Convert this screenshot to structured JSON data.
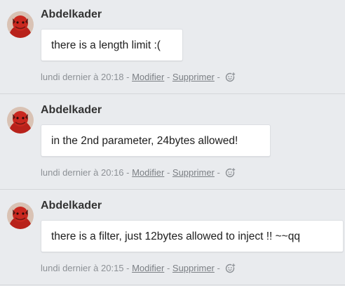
{
  "colors": {
    "background": "#e9ebee",
    "bubble": "#ffffff",
    "meta_text": "#8d9196",
    "author_text": "#333333"
  },
  "messages": [
    {
      "author": "Abdelkader",
      "text": "there is a length limit :(",
      "timestamp": "lundi dernier à 20:18",
      "edit_label": "Modifier",
      "delete_label": "Supprimer",
      "separator": " - ",
      "react_icon": "add-reaction-icon"
    },
    {
      "author": "Abdelkader",
      "text": "in the 2nd parameter, 24bytes allowed!",
      "timestamp": "lundi dernier à 20:16",
      "edit_label": "Modifier",
      "delete_label": "Supprimer",
      "separator": " - ",
      "react_icon": "add-reaction-icon"
    },
    {
      "author": "Abdelkader",
      "text": "there is a filter, just 12bytes allowed to inject !! ~~qq",
      "timestamp": "lundi dernier à 20:15",
      "edit_label": "Modifier",
      "delete_label": "Supprimer",
      "separator": " - ",
      "react_icon": "add-reaction-icon"
    }
  ]
}
